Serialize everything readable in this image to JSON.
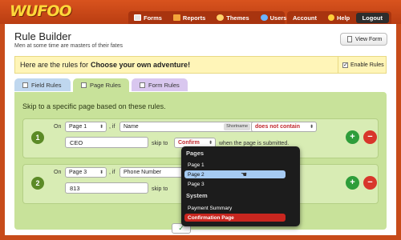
{
  "app": {
    "logo": "WUFOO"
  },
  "nav": {
    "main": [
      {
        "label": "Forms",
        "icon": "forms-icon"
      },
      {
        "label": "Reports",
        "icon": "reports-icon"
      },
      {
        "label": "Themes",
        "icon": "themes-icon"
      },
      {
        "label": "Users",
        "icon": "users-icon"
      }
    ],
    "right": [
      {
        "label": "Account"
      },
      {
        "label": "Help",
        "icon": "help-icon"
      },
      {
        "label": "Logout"
      }
    ]
  },
  "page": {
    "title": "Rule Builder",
    "subtitle": "Men at some time are masters of their fates",
    "view_form_label": "View Form"
  },
  "banner": {
    "prefix": "Here are the rules for",
    "form_name": "Choose your own adventure!",
    "enable_label": "Enable Rules"
  },
  "tabs": [
    {
      "label": "Field Rules"
    },
    {
      "label": "Page Rules"
    },
    {
      "label": "Form Rules"
    }
  ],
  "rules": {
    "heading": "Skip to a specific page based on these rules.",
    "items": [
      {
        "number": "1",
        "on_label": "On",
        "page": "Page 1",
        "if_label": ", if",
        "field": "Name",
        "field_badge": "Shortname",
        "condition": "does not contain",
        "value": "CEO",
        "skip_label": "skip to",
        "target": "Confirm",
        "tail": "when the page is submitted."
      },
      {
        "number": "2",
        "on_label": "On",
        "page": "Page 3",
        "if_label": ", if",
        "field": "Phone Number",
        "value": "813",
        "skip_label": "skip to"
      }
    ],
    "save_symbol": "✓"
  },
  "dropdown": {
    "pages_heading": "Pages",
    "pages": [
      "Page 1",
      "Page 2",
      "Page 3"
    ],
    "system_heading": "System",
    "system": [
      "Payment Summary",
      "Confirmation Page"
    ],
    "selected": "Page 2"
  },
  "colors": {
    "brand_orange": "#c74b1a",
    "logo_yellow": "#ffd83a",
    "rules_green": "#c8e29a",
    "danger_red": "#d8362b",
    "add_green": "#2e9d3a"
  }
}
